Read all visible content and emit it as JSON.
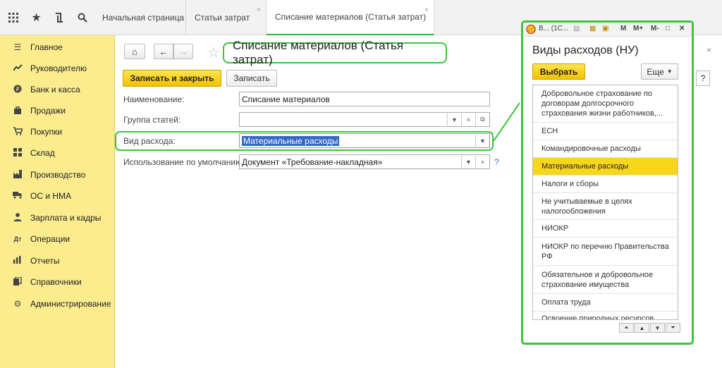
{
  "tabs": [
    {
      "label": "Начальная страница"
    },
    {
      "label": "Статьи затрат"
    },
    {
      "label": "Списание материалов (Статья затрат)"
    }
  ],
  "sidebar": {
    "items": [
      {
        "label": "Главное",
        "icon": "menu-icon"
      },
      {
        "label": "Руководителю",
        "icon": "trend-icon"
      },
      {
        "label": "Банк и касса",
        "icon": "coin-icon"
      },
      {
        "label": "Продажи",
        "icon": "bag-icon"
      },
      {
        "label": "Покупки",
        "icon": "cart-icon"
      },
      {
        "label": "Склад",
        "icon": "warehouse-icon"
      },
      {
        "label": "Производство",
        "icon": "factory-icon"
      },
      {
        "label": "ОС и НМА",
        "icon": "truck-icon"
      },
      {
        "label": "Зарплата и кадры",
        "icon": "person-icon"
      },
      {
        "label": "Операции",
        "icon": "operations-icon"
      },
      {
        "label": "Отчеты",
        "icon": "bar-chart-icon"
      },
      {
        "label": "Справочники",
        "icon": "books-icon"
      },
      {
        "label": "Администрирование",
        "icon": "gear-icon"
      }
    ]
  },
  "form": {
    "title": "Списание материалов (Статья затрат)",
    "save_close_label": "Записать и закрыть",
    "save_label": "Записать",
    "help_label": "?",
    "fields": {
      "name": {
        "label": "Наименование:",
        "value": "Списание материалов"
      },
      "group": {
        "label": "Группа статей:",
        "value": ""
      },
      "expense_type": {
        "label": "Вид расхода:",
        "value": "Материальные расходы"
      },
      "default_usage": {
        "label": "Использование по умолчанию:",
        "value": "Документ «Требование-накладная»"
      }
    },
    "field_help": "?"
  },
  "popup": {
    "window_title": "В... (1С...",
    "toolbar_labels": {
      "m": "M",
      "mplus": "M+",
      "mminus": "M-"
    },
    "heading": "Виды расходов (НУ)",
    "select_label": "Выбрать",
    "more_label": "Еще",
    "items": [
      {
        "label": "Добровольное страхование по договорам долгосрочного страхования жизни работников,...",
        "selected": false
      },
      {
        "label": "ЕСН",
        "selected": false
      },
      {
        "label": "Командировочные расходы",
        "selected": false
      },
      {
        "label": "Материальные расходы",
        "selected": true
      },
      {
        "label": "Налоги и сборы",
        "selected": false
      },
      {
        "label": "Не учитываемые в целях налогообложения",
        "selected": false
      },
      {
        "label": "НИОКР",
        "selected": false
      },
      {
        "label": "НИОКР по перечню Правительства РФ",
        "selected": false
      },
      {
        "label": "Обязательное и добровольное страхование имущества",
        "selected": false
      },
      {
        "label": "Оплата труда",
        "selected": false
      },
      {
        "label": "Освоение природных ресурсов",
        "selected": false
      }
    ]
  },
  "colors": {
    "accent_green": "#3ec43e",
    "sidebar_yellow": "#fbec8e",
    "button_yellow": "#f7d61c",
    "selection_blue": "#3468c6"
  }
}
